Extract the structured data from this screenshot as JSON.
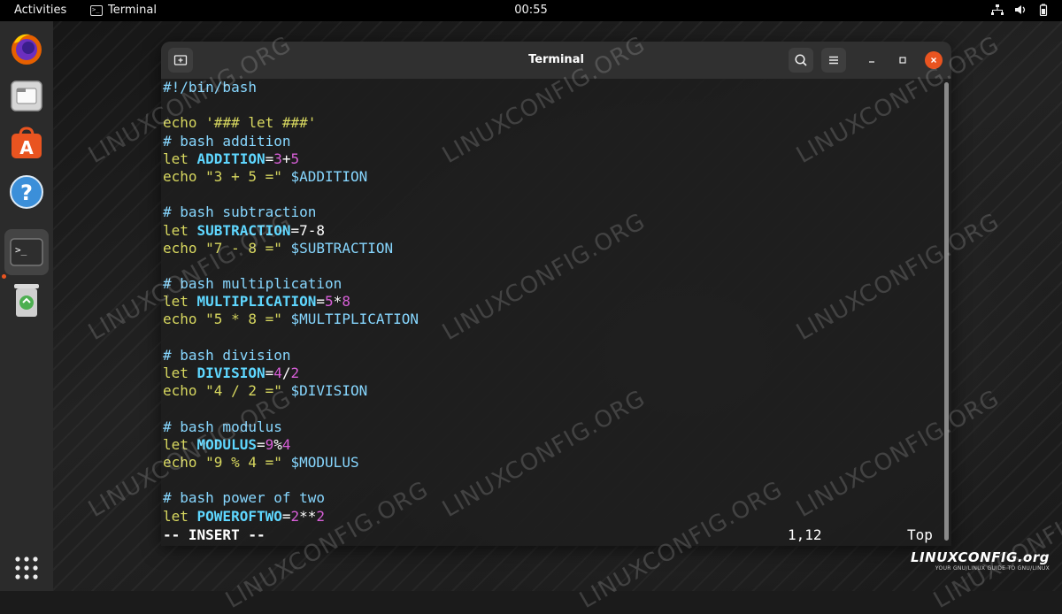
{
  "topbar": {
    "activities": "Activities",
    "app_name": "Terminal",
    "clock": "00:55"
  },
  "dock": {
    "items": [
      "firefox-icon",
      "files-icon",
      "software-icon",
      "help-icon",
      "terminal-icon",
      "trash-icon",
      "app-grid-icon"
    ]
  },
  "window": {
    "title": "Terminal",
    "buttons": [
      "new-tab-icon",
      "search-icon",
      "hamburger-menu-icon",
      "minimize-icon",
      "maximize-icon",
      "close-icon"
    ],
    "close_color": "#e95420"
  },
  "editor": {
    "lines": [
      [
        {
          "c": "shebang",
          "t": "#!/bin/bash"
        }
      ],
      [],
      [
        {
          "c": "kw",
          "t": "echo "
        },
        {
          "c": "str",
          "t": "'### let ###'"
        }
      ],
      [
        {
          "c": "comment",
          "t": "# bash addition"
        }
      ],
      [
        {
          "c": "kw",
          "t": "let "
        },
        {
          "c": "var",
          "t": "ADDITION"
        },
        {
          "c": "plain",
          "t": "="
        },
        {
          "c": "num",
          "t": "3"
        },
        {
          "c": "plain",
          "t": "+"
        },
        {
          "c": "num",
          "t": "5"
        }
      ],
      [
        {
          "c": "kw",
          "t": "echo "
        },
        {
          "c": "str",
          "t": "\"3 + 5 =\""
        },
        {
          "c": "plain",
          "t": " "
        },
        {
          "c": "dollar",
          "t": "$ADDITION"
        }
      ],
      [],
      [
        {
          "c": "comment",
          "t": "# bash subtraction"
        }
      ],
      [
        {
          "c": "kw",
          "t": "let "
        },
        {
          "c": "var",
          "t": "SUBTRACTION"
        },
        {
          "c": "plain",
          "t": "=7-8"
        }
      ],
      [
        {
          "c": "kw",
          "t": "echo "
        },
        {
          "c": "str",
          "t": "\"7 - 8 =\""
        },
        {
          "c": "plain",
          "t": " "
        },
        {
          "c": "dollar",
          "t": "$SUBTRACTION"
        }
      ],
      [],
      [
        {
          "c": "comment",
          "t": "# bash multiplication"
        }
      ],
      [
        {
          "c": "kw",
          "t": "let "
        },
        {
          "c": "var",
          "t": "MULTIPLICATION"
        },
        {
          "c": "plain",
          "t": "="
        },
        {
          "c": "num",
          "t": "5"
        },
        {
          "c": "plain",
          "t": "*"
        },
        {
          "c": "num",
          "t": "8"
        }
      ],
      [
        {
          "c": "kw",
          "t": "echo "
        },
        {
          "c": "str",
          "t": "\"5 * 8 =\""
        },
        {
          "c": "plain",
          "t": " "
        },
        {
          "c": "dollar",
          "t": "$MULTIPLICATION"
        }
      ],
      [],
      [
        {
          "c": "comment",
          "t": "# bash division"
        }
      ],
      [
        {
          "c": "kw",
          "t": "let "
        },
        {
          "c": "var",
          "t": "DIVISION"
        },
        {
          "c": "plain",
          "t": "="
        },
        {
          "c": "num",
          "t": "4"
        },
        {
          "c": "plain",
          "t": "/"
        },
        {
          "c": "num",
          "t": "2"
        }
      ],
      [
        {
          "c": "kw",
          "t": "echo "
        },
        {
          "c": "str",
          "t": "\"4 / 2 =\""
        },
        {
          "c": "plain",
          "t": " "
        },
        {
          "c": "dollar",
          "t": "$DIVISION"
        }
      ],
      [],
      [
        {
          "c": "comment",
          "t": "# bash modulus"
        }
      ],
      [
        {
          "c": "kw",
          "t": "let "
        },
        {
          "c": "var",
          "t": "MODULUS"
        },
        {
          "c": "plain",
          "t": "="
        },
        {
          "c": "num",
          "t": "9"
        },
        {
          "c": "plain",
          "t": "%"
        },
        {
          "c": "num",
          "t": "4"
        }
      ],
      [
        {
          "c": "kw",
          "t": "echo "
        },
        {
          "c": "str",
          "t": "\"9 % 4 =\""
        },
        {
          "c": "plain",
          "t": " "
        },
        {
          "c": "dollar",
          "t": "$MODULUS"
        }
      ],
      [],
      [
        {
          "c": "comment",
          "t": "# bash power of two"
        }
      ],
      [
        {
          "c": "kw",
          "t": "let "
        },
        {
          "c": "var",
          "t": "POWEROFTWO"
        },
        {
          "c": "plain",
          "t": "="
        },
        {
          "c": "num",
          "t": "2"
        },
        {
          "c": "plain",
          "t": "**"
        },
        {
          "c": "num",
          "t": "2"
        }
      ]
    ],
    "status_mode": "-- INSERT --",
    "cursor_position": "1,12",
    "scroll_position": "Top"
  },
  "watermark": {
    "text": "LINUXCONFIG.ORG"
  },
  "brand": {
    "logo_text": "LINUXCONFIG.org",
    "tagline": "YOUR GNU/LINUX GUIDE TO GNU/LINUX"
  }
}
